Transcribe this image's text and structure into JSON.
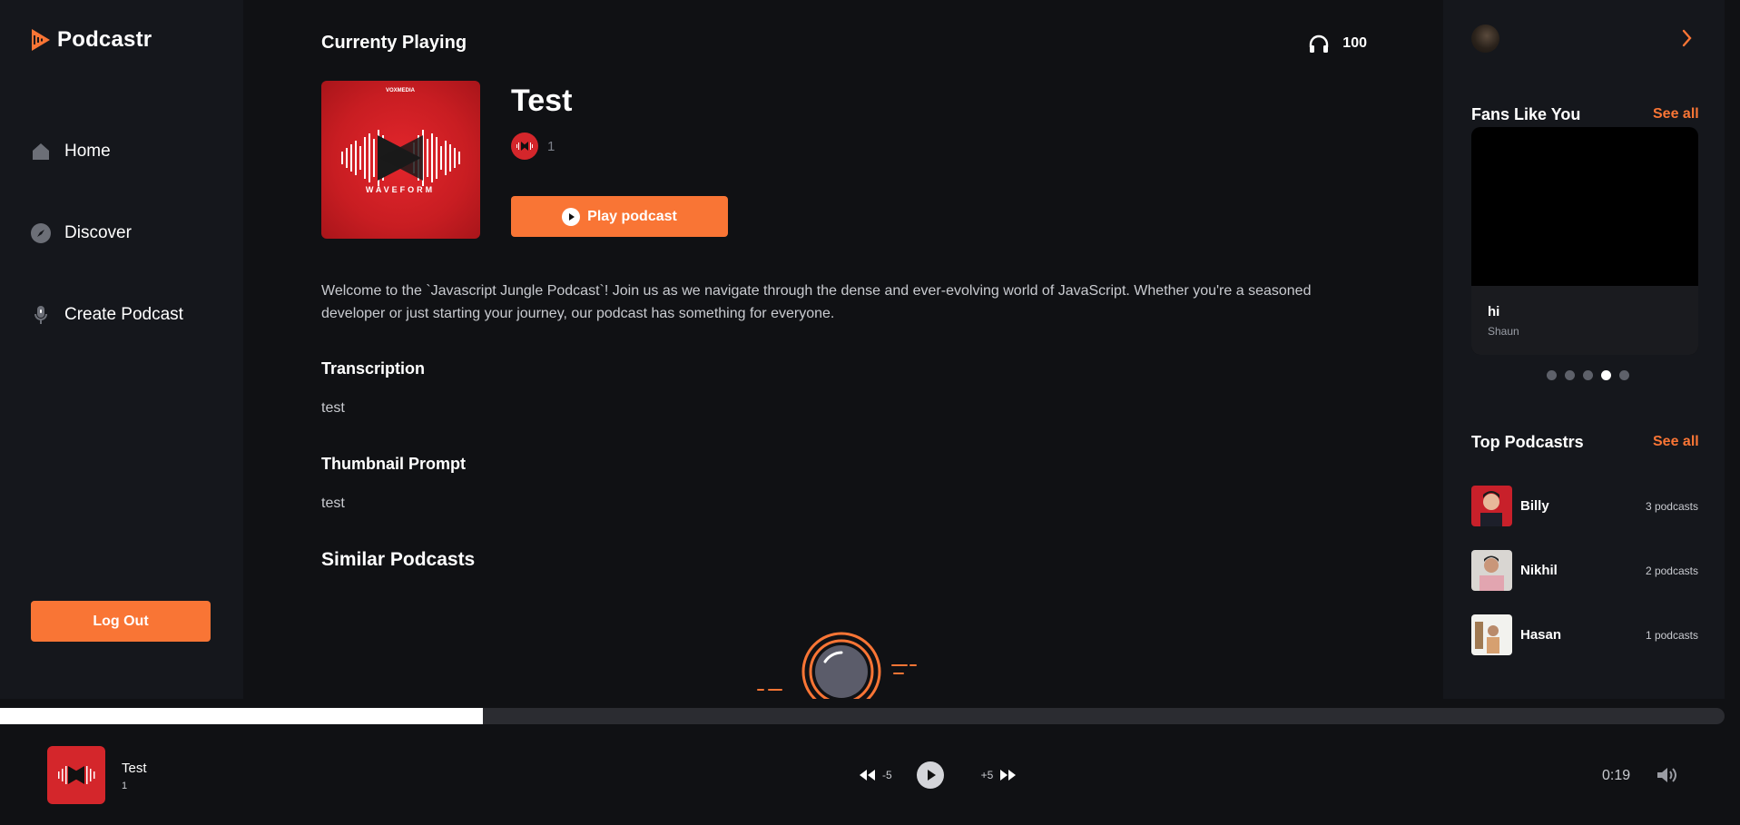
{
  "app": {
    "name": "Podcastr"
  },
  "nav": {
    "items": [
      {
        "label": "Home",
        "icon": "home-icon"
      },
      {
        "label": "Discover",
        "icon": "compass-icon"
      },
      {
        "label": "Create Podcast",
        "icon": "microphone-icon"
      }
    ],
    "logout_label": "Log Out"
  },
  "podcast": {
    "section_title": "Currenty Playing",
    "listeners": "100",
    "title": "Test",
    "author_count": "1",
    "cover_brand": "VOXMEDIA",
    "cover_name": "WAVEFORM",
    "play_label": "Play podcast",
    "description": "Welcome to the `Javascript Jungle Podcast`! Join us as we navigate through the dense and ever-evolving world of JavaScript. Whether you're a seasoned developer or just starting your journey, our podcast has something for everyone.",
    "transcription_label": "Transcription",
    "transcription": "test",
    "thumbnail_label": "Thumbnail Prompt",
    "thumbnail_prompt": "test",
    "similar_label": "Similar Podcasts"
  },
  "right": {
    "fans_title": "Fans Like You",
    "fans_see_all": "See all",
    "fan_card": {
      "title": "hi",
      "subtitle": "Shaun"
    },
    "carousel": {
      "count": 5,
      "active_index": 3
    },
    "top_title": "Top Podcastrs",
    "top_see_all": "See all",
    "top_podcasters": [
      {
        "name": "Billy",
        "count": "3 podcasts"
      },
      {
        "name": "Nikhil",
        "count": "2 podcasts"
      },
      {
        "name": "Hasan",
        "count": "1 podcasts"
      }
    ]
  },
  "player": {
    "title": "Test",
    "author": "1",
    "rewind_label": "-5",
    "forward_label": "+5",
    "time": "0:19",
    "progress": 0.28
  },
  "colors": {
    "accent": "#f97535",
    "background": "#101114",
    "panel": "#15171c"
  }
}
